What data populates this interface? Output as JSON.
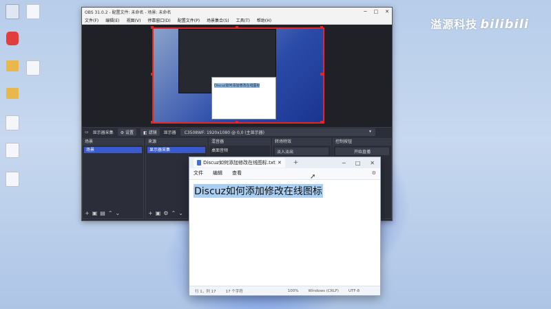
{
  "watermark": {
    "text": "溢源科技",
    "bili": "bilibili"
  },
  "desktop_icons": [
    {
      "label": ""
    },
    {
      "label": ""
    },
    {
      "label": ""
    },
    {
      "label": ""
    },
    {
      "label": ""
    },
    {
      "label": ""
    },
    {
      "label": ""
    },
    {
      "label": ""
    },
    {
      "label": ""
    },
    {
      "label": ""
    }
  ],
  "obs": {
    "title": "OBS 31.0.2 - 配置文件: 未命名 - 场景: 未命名",
    "menu": [
      "文件(F)",
      "编辑(E)",
      "视图(V)",
      "停靠窗口(D)",
      "配置文件(P)",
      "场景集合(S)",
      "工具(T)",
      "帮助(H)"
    ],
    "preview_overlay_text": "Discuz如何添加修改在线图标",
    "source_toolbar": {
      "source_name": "显示器采集",
      "settings": "设置",
      "filters": "滤镜",
      "display_label": "显示器",
      "display_value": "C3508WF: 1920x1080 @ 0,0 (主显示器)"
    },
    "docks": {
      "scenes": {
        "title": "场景",
        "item": "场景"
      },
      "sources": {
        "title": "来源",
        "item": "显示器采集"
      },
      "mixer": {
        "title": "混音器",
        "item": "桌面音频"
      },
      "transitions": {
        "title": "转场特效",
        "item": "淡入淡出"
      },
      "controls": {
        "title": "控制按钮",
        "item": "开始直播"
      }
    }
  },
  "notepad": {
    "tab_title": "Discuz如何添加修改在线图标.txt",
    "add_tab": "+",
    "menu": [
      "文件",
      "编辑",
      "查看"
    ],
    "content": "Discuz如何添加修改在线图标",
    "status": {
      "position": "行 1，列 17",
      "chars": "17 个字符",
      "zoom": "100%",
      "line_ending": "Windows (CRLF)",
      "encoding": "UTF-8"
    }
  }
}
